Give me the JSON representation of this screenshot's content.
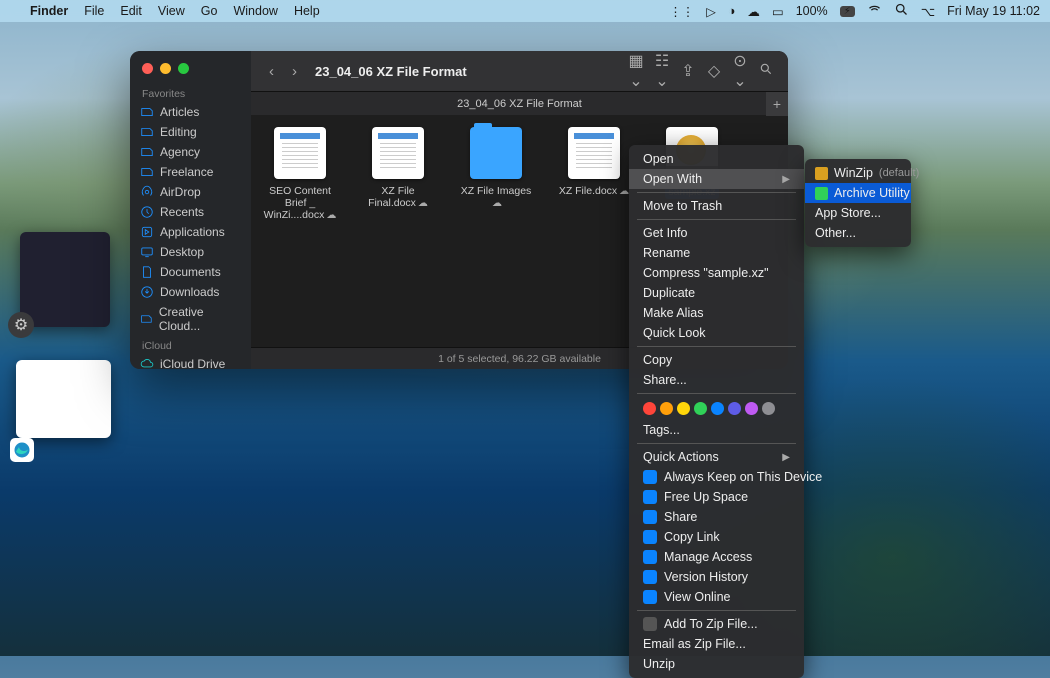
{
  "menubar": {
    "app": "Finder",
    "items": [
      "File",
      "Edit",
      "View",
      "Go",
      "Window",
      "Help"
    ],
    "battery": "100%",
    "datetime": "Fri May 19  11:02"
  },
  "finder": {
    "title": "23_04_06 XZ File Format",
    "path": "23_04_06 XZ File Format",
    "status": "1 of 5 selected, 96.22 GB available",
    "sidebar": {
      "favorites_label": "Favorites",
      "icloud_label": "iCloud",
      "items": [
        "Articles",
        "Editing",
        "Agency",
        "Freelance",
        "AirDrop",
        "Recents",
        "Applications",
        "Desktop",
        "Documents",
        "Downloads",
        "Creative Cloud..."
      ],
      "icloud_items": [
        "iCloud Drive"
      ]
    },
    "files": [
      {
        "name": "SEO Content Brief _ WinZi....docx",
        "type": "doc",
        "cloud": true
      },
      {
        "name": "XZ File Final.docx",
        "type": "doc",
        "cloud": true
      },
      {
        "name": "XZ File Images",
        "type": "folder",
        "cloud": true
      },
      {
        "name": "XZ File.docx",
        "type": "doc",
        "cloud": true
      },
      {
        "name": "sample.xz",
        "type": "xz",
        "cloud": false,
        "selected": true
      }
    ]
  },
  "context_menu": {
    "open": "Open",
    "open_with": "Open With",
    "trash": "Move to Trash",
    "getinfo": "Get Info",
    "rename": "Rename",
    "compress": "Compress \"sample.xz\"",
    "duplicate": "Duplicate",
    "alias": "Make Alias",
    "quicklook": "Quick Look",
    "copy": "Copy",
    "share": "Share...",
    "tags": "Tags...",
    "quick_actions": "Quick Actions",
    "qa": [
      "Always Keep on This Device",
      "Free Up Space",
      "Share",
      "Copy Link",
      "Manage Access",
      "Version History",
      "View Online"
    ],
    "addzip": "Add To Zip File...",
    "emailzip": "Email as Zip File...",
    "unzip": "Unzip"
  },
  "open_with_menu": {
    "default_app": "WinZip",
    "default_suffix": "(default)",
    "highlighted": "Archive Utility",
    "appstore": "App Store...",
    "other": "Other..."
  },
  "tag_colors": [
    "#ff453a",
    "#ff9f0a",
    "#ffd60a",
    "#30d158",
    "#0a84ff",
    "#5e5ce6",
    "#bf5af2",
    "#8e8e93"
  ]
}
